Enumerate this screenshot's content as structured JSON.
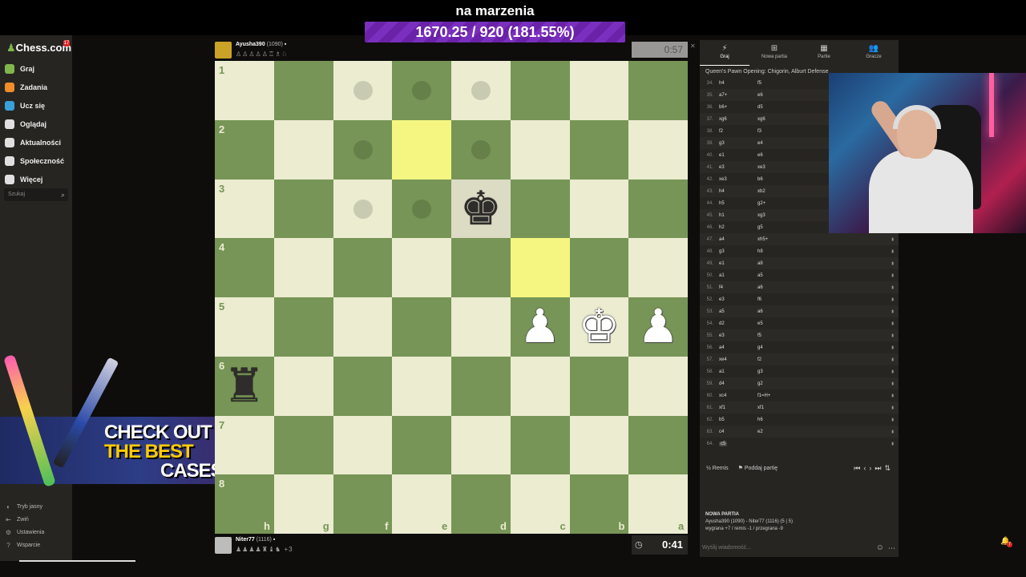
{
  "overlay": {
    "title": "na marzenia",
    "goal": "1670.25 / 920 (181.55%)",
    "ad_line1": "CHECK OUT",
    "ad_line2": "THE BEST",
    "ad_line3": "CASES"
  },
  "sidebar": {
    "logo": "Chess.com",
    "logo_badge": "17",
    "items": [
      {
        "label": "Graj",
        "icon": "pawn-icon",
        "color": "#81b64c"
      },
      {
        "label": "Zadania",
        "icon": "puzzle-icon",
        "color": "#f08c2a"
      },
      {
        "label": "Ucz się",
        "icon": "learn-icon",
        "color": "#3aa0d8"
      },
      {
        "label": "Oglądaj",
        "icon": "watch-icon",
        "color": "#e0e0e0"
      },
      {
        "label": "Aktualności",
        "icon": "news-icon",
        "color": "#e0e0e0"
      },
      {
        "label": "Społeczność",
        "icon": "community-icon",
        "color": "#e0e0e0"
      },
      {
        "label": "Więcej",
        "icon": "more-icon",
        "color": "#e0e0e0"
      }
    ],
    "search_placeholder": "Szukaj",
    "bottom_items": [
      {
        "label": "Tryb jasny"
      },
      {
        "label": "Zwiń"
      },
      {
        "label": "Ustawienia"
      },
      {
        "label": "Wsparcie"
      }
    ]
  },
  "top_player": {
    "name": "Ayusha390",
    "rating": "(1090)",
    "clock": "0:57"
  },
  "bottom_player": {
    "name": "Niter77",
    "rating": "(1116)",
    "extra": "+3",
    "clock": "0:41"
  },
  "board": {
    "ranks": [
      "1",
      "2",
      "3",
      "4",
      "5",
      "6",
      "7",
      "8"
    ],
    "files": [
      "h",
      "g",
      "f",
      "e",
      "d",
      "c",
      "b",
      "a"
    ],
    "highlight": [
      [
        1,
        3
      ],
      [
        3,
        5
      ]
    ],
    "dots": [
      [
        0,
        2
      ],
      [
        0,
        3
      ],
      [
        0,
        4
      ],
      [
        1,
        2
      ],
      [
        1,
        4
      ],
      [
        2,
        2
      ],
      [
        2,
        3
      ]
    ],
    "pieces": [
      {
        "row": 2,
        "col": 4,
        "glyph": "♚",
        "color": "black",
        "name": "black-king"
      },
      {
        "row": 4,
        "col": 5,
        "glyph": "♟",
        "color": "white",
        "name": "white-pawn-c5"
      },
      {
        "row": 4,
        "col": 6,
        "glyph": "♚",
        "color": "white",
        "name": "white-king"
      },
      {
        "row": 4,
        "col": 7,
        "glyph": "♟",
        "color": "white",
        "name": "white-pawn-a5"
      },
      {
        "row": 5,
        "col": 0,
        "glyph": "♜",
        "color": "black",
        "name": "black-rook"
      }
    ]
  },
  "panel": {
    "tabs": [
      {
        "label": "Graj",
        "icon": "⚡"
      },
      {
        "label": "Nowa partia",
        "icon": "⊞"
      },
      {
        "label": "Partie",
        "icon": "▦"
      },
      {
        "label": "Gracze",
        "icon": "👥"
      }
    ],
    "opening": "Queen's Pawn Opening: Chigorin, Alburt Defense",
    "moves": [
      {
        "n": "34.",
        "w": "h4",
        "b": "f5"
      },
      {
        "n": "35.",
        "w": "a7+",
        "b": "e6"
      },
      {
        "n": "36.",
        "w": "b6+",
        "b": "d5"
      },
      {
        "n": "37.",
        "w": "xg6",
        "b": "xg6"
      },
      {
        "n": "38.",
        "w": "f2",
        "b": "f3"
      },
      {
        "n": "39.",
        "w": "g3",
        "b": "e4"
      },
      {
        "n": "40.",
        "w": "e1",
        "b": "e6"
      },
      {
        "n": "41.",
        "w": "e3",
        "b": "xe3"
      },
      {
        "n": "42.",
        "w": "xe3",
        "b": "b6"
      },
      {
        "n": "43.",
        "w": "h4",
        "b": "xb2"
      },
      {
        "n": "44.",
        "w": "h5",
        "b": "g2+"
      },
      {
        "n": "45.",
        "w": "h1",
        "b": "xg3"
      },
      {
        "n": "46.",
        "w": "h2",
        "b": "g5"
      },
      {
        "n": "47.",
        "w": "a4",
        "b": "xh5+"
      },
      {
        "n": "48.",
        "w": "g3",
        "b": "h8"
      },
      {
        "n": "49.",
        "w": "e1",
        "b": "a8"
      },
      {
        "n": "50.",
        "w": "a1",
        "b": "a5"
      },
      {
        "n": "51.",
        "w": "f4",
        "b": "a6"
      },
      {
        "n": "52.",
        "w": "e3",
        "b": "f6"
      },
      {
        "n": "53.",
        "w": "a5",
        "b": "a6"
      },
      {
        "n": "54.",
        "w": "d2",
        "b": "e5"
      },
      {
        "n": "55.",
        "w": "e3",
        "b": "f5"
      },
      {
        "n": "56.",
        "w": "a4",
        "b": "g4"
      },
      {
        "n": "57.",
        "w": "xe4",
        "b": "f2"
      },
      {
        "n": "58.",
        "w": "a1",
        "b": "g3"
      },
      {
        "n": "59.",
        "w": "d4",
        "b": "g2"
      },
      {
        "n": "60.",
        "w": "xc4",
        "b": "f1=H+"
      },
      {
        "n": "61.",
        "w": "xf1",
        "b": "xf1"
      },
      {
        "n": "62.",
        "w": "b5",
        "b": "h6"
      },
      {
        "n": "63.",
        "w": "c4",
        "b": "e2"
      },
      {
        "n": "64.",
        "w": "c5",
        "b": ""
      }
    ],
    "draw_label": "Remis",
    "resign_label": "Poddaj partię",
    "new_game_title": "NOWA PARTIA",
    "new_game_players": "Ayusha390 (1090) - Niter77 (1116) (5 | 5)",
    "new_game_stats": "wygrana +7 / remis -1 / przegrana -9",
    "chat_placeholder": "Wyślij wiadomość..."
  },
  "notifications": {
    "count": "7"
  }
}
